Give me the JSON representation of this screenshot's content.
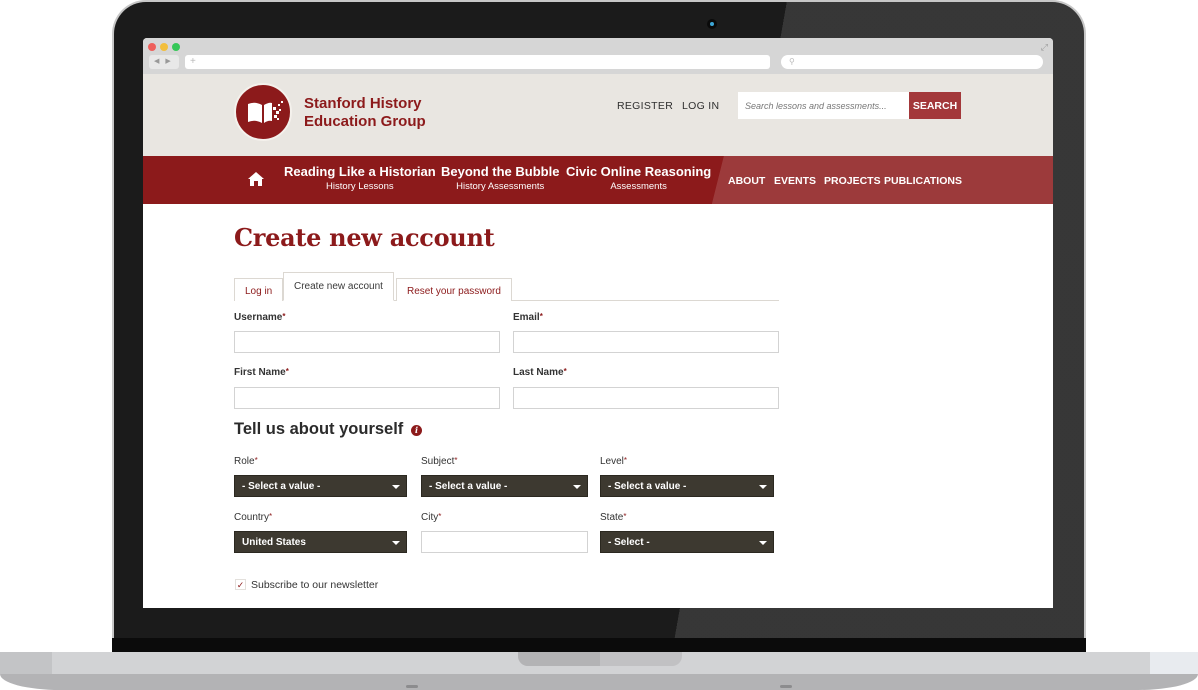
{
  "browser": {
    "address_placeholder": "+",
    "search_placeholder": ""
  },
  "site": {
    "name_line1": "Stanford History",
    "name_line2": "Education Group",
    "brand_color": "#8c1a1b",
    "header_links": {
      "register": "REGISTER",
      "login": "LOG IN"
    },
    "search": {
      "placeholder": "Search lessons and assessments...",
      "button": "SEARCH"
    }
  },
  "nav": {
    "home_icon": "home-icon",
    "items": [
      {
        "title": "Reading Like a Historian",
        "sub": "History Lessons"
      },
      {
        "title": "Beyond the Bubble",
        "sub": "History Assessments"
      },
      {
        "title": "Civic Online Reasoning",
        "sub": "Assessments"
      }
    ],
    "links": [
      "ABOUT",
      "EVENTS",
      "PROJECTS",
      "PUBLICATIONS"
    ]
  },
  "page": {
    "title": "Create new account",
    "tabs": [
      {
        "label": "Log in",
        "active": false
      },
      {
        "label": "Create new account",
        "active": true
      },
      {
        "label": "Reset your password",
        "active": false
      }
    ],
    "fields": {
      "username": {
        "label": "Username",
        "value": ""
      },
      "email": {
        "label": "Email",
        "value": ""
      },
      "first_name": {
        "label": "First Name",
        "value": ""
      },
      "last_name": {
        "label": "Last Name",
        "value": ""
      }
    },
    "required_marker": "*",
    "about_section": {
      "title": "Tell us about yourself",
      "info_icon": "info-icon",
      "role": {
        "label": "Role",
        "selected": "- Select a value -"
      },
      "subject": {
        "label": "Subject",
        "selected": "- Select a value -"
      },
      "level": {
        "label": "Level",
        "selected": "- Select a value -"
      },
      "country": {
        "label": "Country",
        "selected": "United States"
      },
      "city": {
        "label": "City",
        "value": ""
      },
      "state": {
        "label": "State",
        "selected": "- Select -"
      }
    },
    "newsletter": {
      "label": "Subscribe to our newsletter",
      "checked": true,
      "check_glyph": "✓"
    }
  }
}
